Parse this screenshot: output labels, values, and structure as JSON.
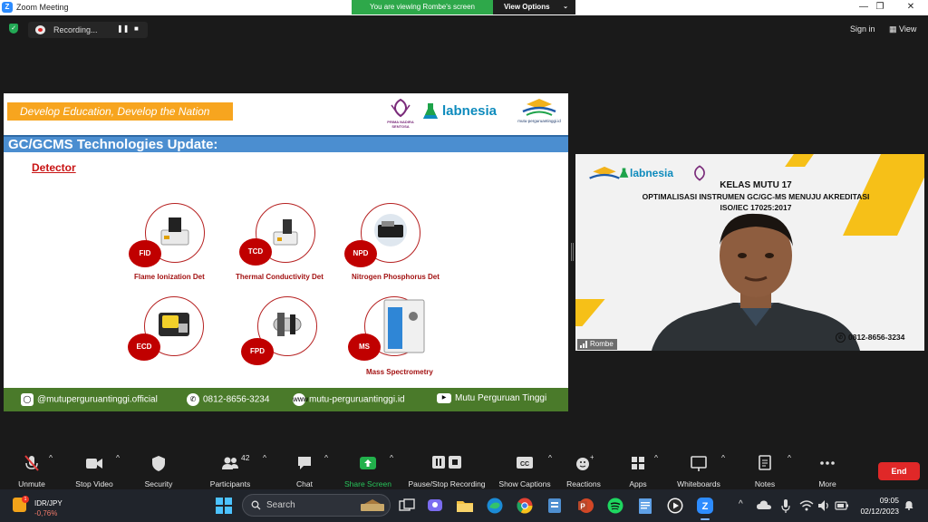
{
  "window": {
    "title": "Zoom Meeting",
    "viewing_banner": "You are viewing Rombe's screen",
    "view_options": "View Options",
    "controls": [
      "—",
      "❐",
      "✕"
    ]
  },
  "topbar": {
    "recording_label": "Recording...",
    "sign_in": "Sign in",
    "view": "View"
  },
  "slide": {
    "banner": "Develop Education, Develop the Nation",
    "pns_caption": "PRIMA NADIRA SENTOSA",
    "labnesia": "labnesia",
    "mutu_caption": "mutu-perguruantinggi.id",
    "title": "GC/GCMS Technologies Update:",
    "subheading": "Detector",
    "detectors": [
      {
        "abbr": "FID",
        "name": "Flame Ionization Det"
      },
      {
        "abbr": "TCD",
        "name": "Thermal Conductivity Det"
      },
      {
        "abbr": "NPD",
        "name": "Nitrogen Phosphorus Det"
      },
      {
        "abbr": "ECD",
        "name": ""
      },
      {
        "abbr": "FPD",
        "name": ""
      },
      {
        "abbr": "MS",
        "name": "Mass Spectrometry"
      }
    ],
    "footer": {
      "instagram": "@mutuperguruantinggi.official",
      "whatsapp": "0812-8656-3234",
      "website": "mutu-perguruantinggi.id",
      "youtube": "Mutu Perguruan Tinggi"
    }
  },
  "video": {
    "labnesia": "labnesia",
    "line1": "KELAS MUTU 17",
    "line2": "OPTIMALISASI INSTRUMEN GC/GC-MS MENUJU AKREDITASI",
    "line3": "ISO/IEC 17025:2017",
    "phone": "0812-8656-3234",
    "participant_name": "Rombe"
  },
  "toolbar": {
    "unmute": "Unmute",
    "stop_video": "Stop Video",
    "security": "Security",
    "participants": "Participants",
    "participants_count": "42",
    "chat": "Chat",
    "share_screen": "Share Screen",
    "pause_stop_recording": "Pause/Stop Recording",
    "show_captions": "Show Captions",
    "reactions": "Reactions",
    "apps": "Apps",
    "whiteboards": "Whiteboards",
    "notes": "Notes",
    "more": "More",
    "end": "End"
  },
  "taskbar": {
    "stock_name": "IDR/JPY",
    "stock_change": "-0,76%",
    "stock_badge": "1",
    "search_placeholder": "Search",
    "time": "09:05",
    "date": "02/12/2023"
  },
  "colors": {
    "zoom_blue": "#2d8cff",
    "viewing_green": "#2ea84a",
    "end_red": "#e02828",
    "slide_banner": "#f7a51f",
    "slide_title": "#4b8ed0",
    "slide_footer": "#4a7a2a",
    "detector_red": "#c00000"
  }
}
